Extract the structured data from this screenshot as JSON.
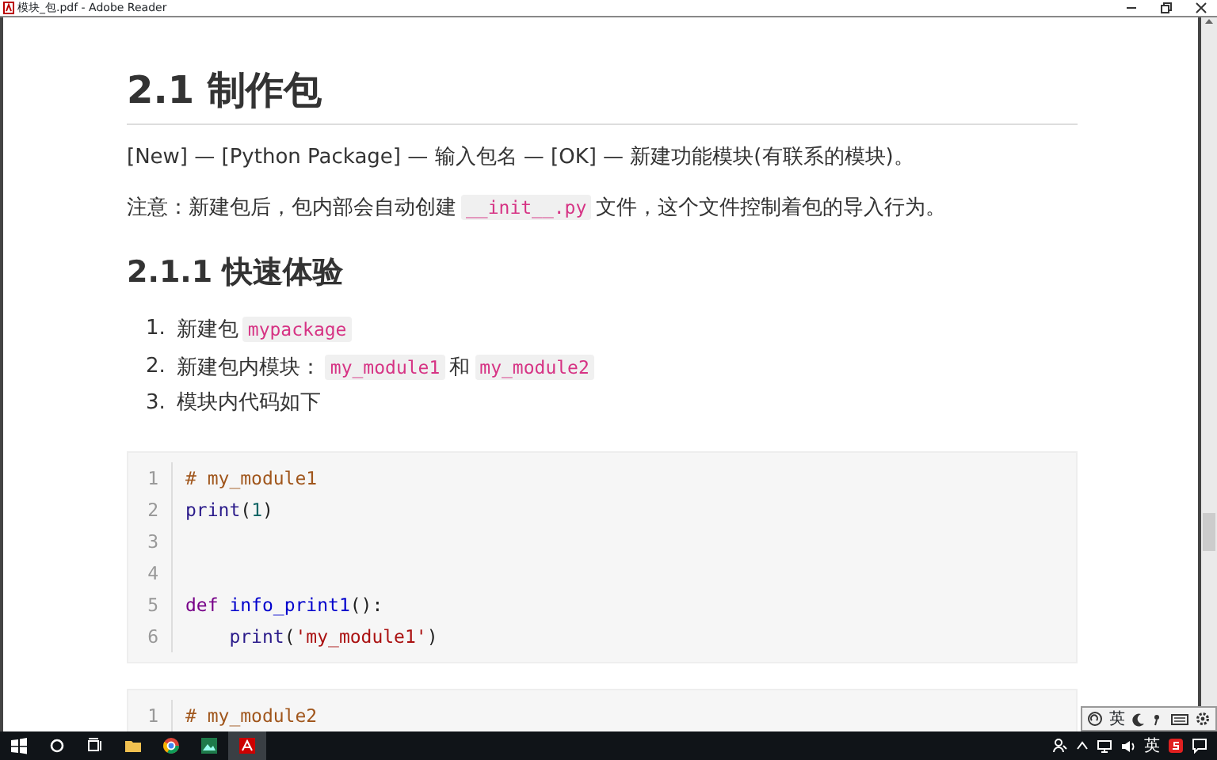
{
  "window": {
    "title": "模块_包.pdf - Adobe Reader"
  },
  "document": {
    "heading": "2.1 制作包",
    "paragraphs": [
      [
        {
          "kind": "text",
          "text": "[New] — [Python Package] — 输入包名 — [OK] — 新建功能模块(有联系的模块)。"
        }
      ],
      [
        {
          "kind": "text",
          "text": "注意：新建包后，包内部会自动创建"
        },
        {
          "kind": "code",
          "text": "__init__.py"
        },
        {
          "kind": "text",
          "text": "文件，这个文件控制着包的导入行为。"
        }
      ]
    ],
    "subheading": "2.1.1 快速体验",
    "list": [
      {
        "number": "1.",
        "parts": [
          {
            "kind": "text",
            "text": "新建包"
          },
          {
            "kind": "code",
            "text": "mypackage"
          }
        ]
      },
      {
        "number": "2.",
        "parts": [
          {
            "kind": "text",
            "text": "新建包内模块："
          },
          {
            "kind": "code",
            "text": "my_module1"
          },
          {
            "kind": "text",
            "text": "和"
          },
          {
            "kind": "code",
            "text": "my_module2"
          }
        ]
      },
      {
        "number": "3.",
        "parts": [
          {
            "kind": "text",
            "text": "模块内代码如下"
          }
        ]
      }
    ],
    "code_blocks": [
      {
        "lines": [
          {
            "number": "1",
            "tokens": [
              {
                "kind": "comment",
                "text": "# my_module1"
              }
            ]
          },
          {
            "number": "2",
            "tokens": [
              {
                "kind": "builtin",
                "text": "print"
              },
              {
                "kind": "plain",
                "text": "("
              },
              {
                "kind": "number",
                "text": "1"
              },
              {
                "kind": "plain",
                "text": ")"
              }
            ]
          },
          {
            "number": "3"
          },
          {
            "number": "4"
          },
          {
            "number": "5",
            "tokens": [
              {
                "kind": "keyword",
                "text": "def"
              },
              {
                "kind": "function",
                "text": "info_print1"
              },
              {
                "kind": "plain",
                "text": "():"
              }
            ]
          },
          {
            "number": "6",
            "indent": true,
            "tokens": [
              {
                "kind": "builtin",
                "text": "print"
              },
              {
                "kind": "plain",
                "text": "("
              },
              {
                "kind": "string",
                "text": "'my_module1'"
              },
              {
                "kind": "plain",
                "text": ")"
              }
            ]
          }
        ]
      },
      {
        "lines": [
          {
            "number": "1",
            "tokens": [
              {
                "kind": "comment",
                "text": "# my_module2"
              }
            ]
          }
        ]
      }
    ]
  },
  "ime_bar": {
    "mode": "英"
  },
  "taskbar": {
    "tray_language": "英"
  }
}
